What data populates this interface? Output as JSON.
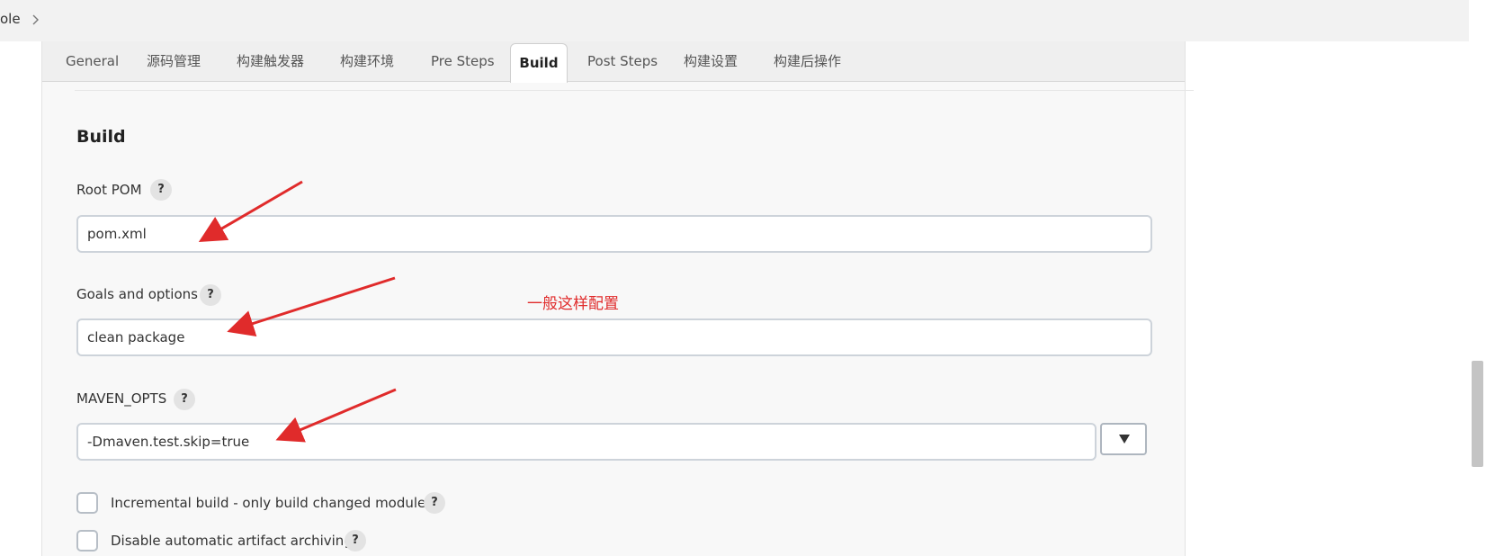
{
  "breadcrumb": {
    "text": "ole"
  },
  "tabs": [
    {
      "label": "General"
    },
    {
      "label": "源码管理"
    },
    {
      "label": "构建触发器"
    },
    {
      "label": "构建环境"
    },
    {
      "label": "Pre Steps"
    },
    {
      "label": "Build",
      "active": true
    },
    {
      "label": "Post Steps"
    },
    {
      "label": "构建设置"
    },
    {
      "label": "构建后操作"
    }
  ],
  "build": {
    "title": "Build",
    "root_pom": {
      "label": "Root POM",
      "help": "?",
      "value": "pom.xml"
    },
    "goals": {
      "label": "Goals and options",
      "help": "?",
      "value": "clean package"
    },
    "maven_opts": {
      "label": "MAVEN_OPTS",
      "help": "?",
      "value": "-Dmaven.test.skip=true"
    },
    "incremental": {
      "label": "Incremental build - only build changed modules",
      "help": "?",
      "checked": false
    },
    "disable_archiving": {
      "label": "Disable automatic artifact archiving",
      "help": "?",
      "checked": false
    }
  },
  "annotation": {
    "text": "一般这样配置",
    "color": "#e02b2b"
  },
  "icons": {
    "breadcrumb_separator": "chevron-right-icon",
    "dropdown": "triangle-down-icon"
  },
  "colors": {
    "panel_bg": "#f8f8f8",
    "tab_bar_bg": "#efefef",
    "arrow": "#e02b2b"
  }
}
